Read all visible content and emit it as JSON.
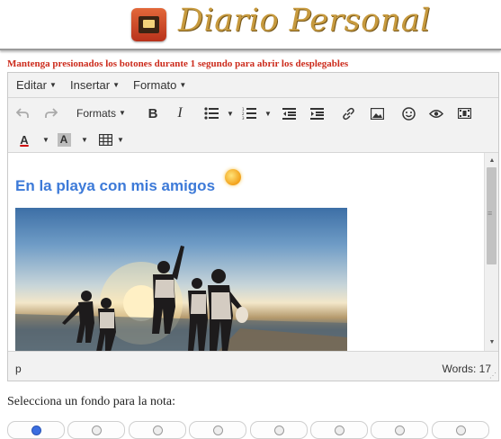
{
  "header": {
    "title": "Diario Personal",
    "logo_icon": "diary-book-icon"
  },
  "hint": "Mantenga presionados los botones durante 1 segundo para abrir los desplegables",
  "menubar": {
    "items": [
      {
        "label": "Editar"
      },
      {
        "label": "Insertar"
      },
      {
        "label": "Formato"
      }
    ]
  },
  "toolbar": {
    "formats_label": "Formats",
    "bold": "B",
    "italic": "I",
    "font_color": "A",
    "bg_color": "A"
  },
  "content": {
    "heading": "En la playa con mis amigos",
    "heading_color": "#3d7ad8"
  },
  "statusbar": {
    "path": "p",
    "words": "Words: 17"
  },
  "background_picker": {
    "label": "Selecciona un fondo para la nota:",
    "options_count": 8,
    "selected_index": 0
  },
  "colors": {
    "hint_red": "#cc2b1c",
    "title_gold": "#c79a3e"
  }
}
